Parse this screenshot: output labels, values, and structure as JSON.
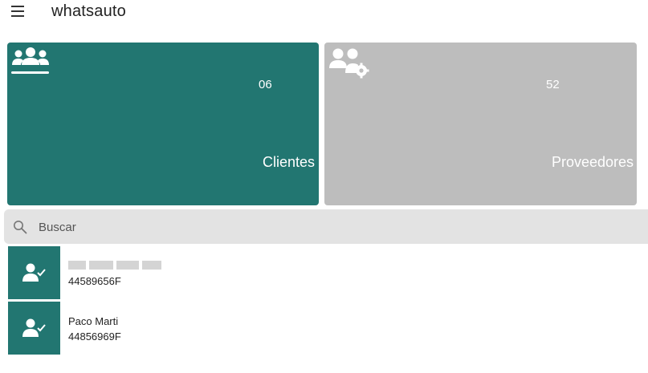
{
  "app": {
    "title": "whatsauto"
  },
  "stats": [
    {
      "count": "06",
      "label": "Clientes"
    },
    {
      "count": "52",
      "label": "Proveedores"
    }
  ],
  "search": {
    "placeholder": "Buscar"
  },
  "list": [
    {
      "name": "",
      "id": "44589656F"
    },
    {
      "name": "Paco Marti",
      "id": "44856969F"
    }
  ],
  "colors": {
    "primary": "#227671",
    "inactive_card": "#bdbdbd",
    "search_bg": "#e3e3e3"
  }
}
